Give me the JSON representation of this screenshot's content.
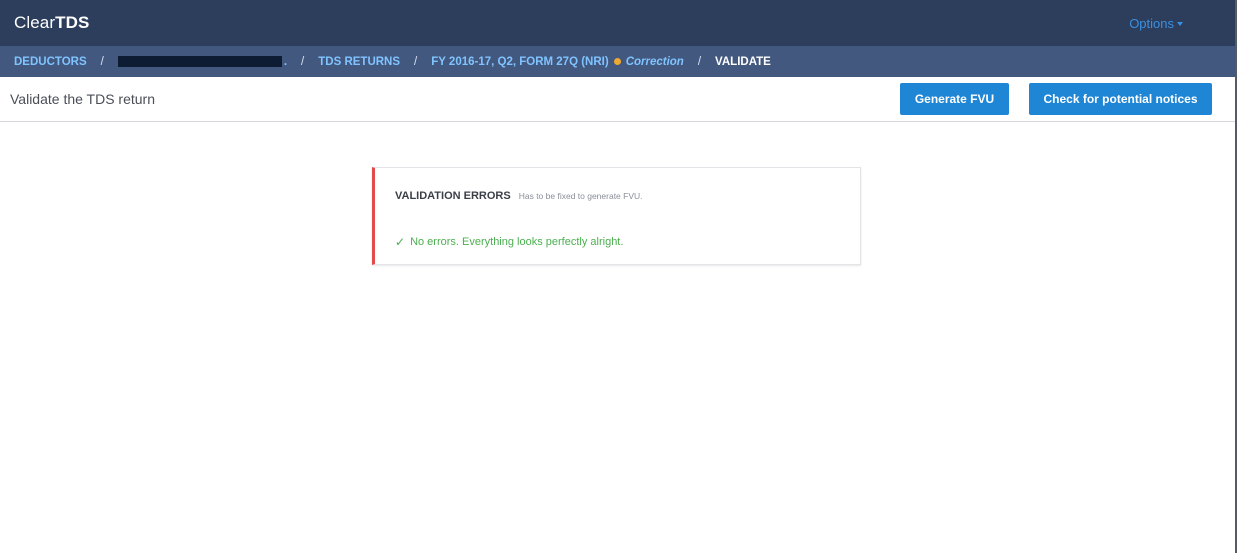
{
  "app": {
    "brand_light": "Clear",
    "brand_bold": "TDS",
    "options_label": "Options"
  },
  "breadcrumb": {
    "deductors": "DEDUCTORS",
    "deductor_suffix": ".",
    "tds_returns": "TDS RETURNS",
    "return_label": "FY 2016-17, Q2, FORM 27Q (NRI)",
    "correction": "Correction",
    "current": "VALIDATE"
  },
  "subheader": {
    "title": "Validate the TDS return",
    "generate_fvu": "Generate FVU",
    "check_notices": "Check for potential notices"
  },
  "validation": {
    "title": "VALIDATION ERRORS",
    "subtitle": "Has to be fixed to generate FVU.",
    "check_glyph": "✓",
    "message": "No errors. Everything looks perfectly alright."
  },
  "colors": {
    "topbar": "#2c3e5c",
    "breadcrumb_bar": "#43587f",
    "link": "#7fc3ff",
    "button": "#1f86d6",
    "error_accent": "#e34a4a",
    "success": "#4caf50",
    "status_dot": "#f0a830"
  }
}
